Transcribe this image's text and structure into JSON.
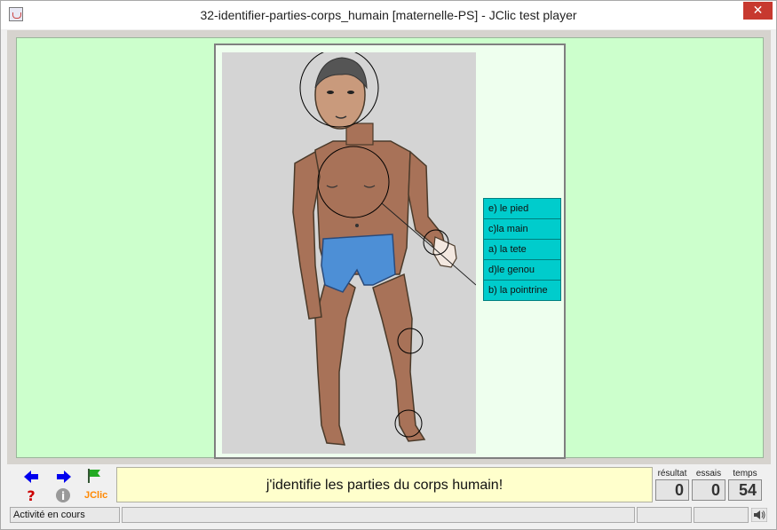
{
  "window": {
    "title": "32-identifier-parties-corps_humain [maternelle-PS] - JClic test player",
    "close_glyph": "✕"
  },
  "activity": {
    "answers": [
      {
        "label": "e) le pied"
      },
      {
        "label": "c)la main"
      },
      {
        "label": "a) la tete"
      },
      {
        "label": "d)le genou"
      },
      {
        "label": "b) la pointrine"
      }
    ]
  },
  "bottom": {
    "message": "j'identifie les parties du corps humain!",
    "nav": {
      "prev_icon": "arrow-left-icon",
      "next_icon": "arrow-right-icon",
      "flag_icon": "green-flag-icon",
      "help_icon": "question-icon",
      "info_icon": "info-icon",
      "logo_text": "JClic"
    },
    "counters": [
      {
        "label": "résultat",
        "value": "0"
      },
      {
        "label": "essais",
        "value": "0"
      },
      {
        "label": "temps",
        "value": "54"
      }
    ]
  },
  "status": {
    "text": "Activité en cours",
    "sound_icon": "speaker-icon"
  },
  "colors": {
    "stage_bg": "#ccffcc",
    "answer_bg": "#00cccc",
    "message_bg": "#ffffcc",
    "arrow_blue": "#0000ee",
    "flag_green": "#22aa22",
    "help_red": "#cc0000",
    "logo_orange": "#ff8800"
  }
}
